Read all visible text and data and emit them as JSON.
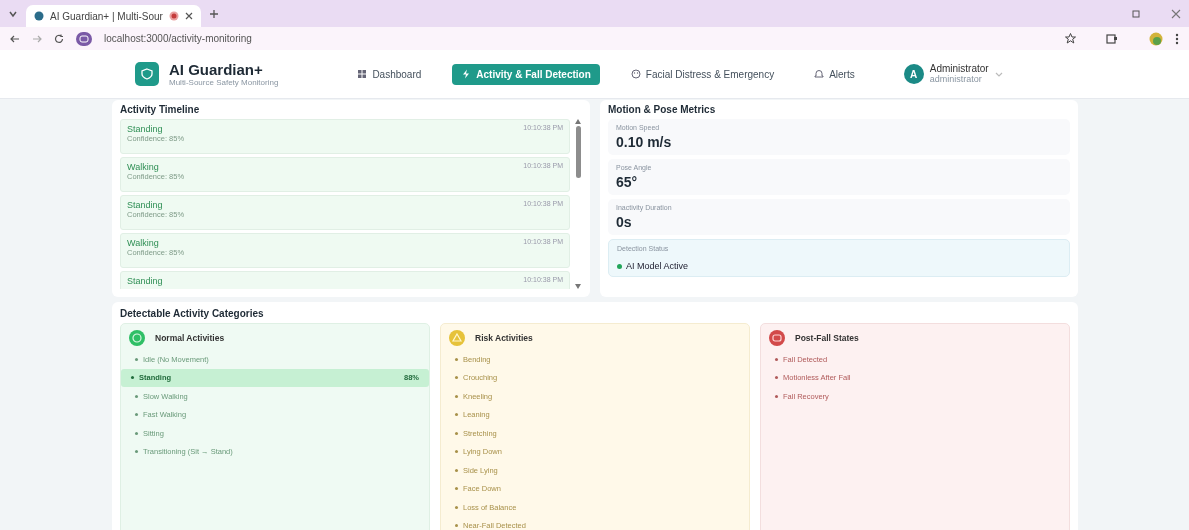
{
  "browser": {
    "tab_title": "AI Guardian+ | Multi-Sour",
    "url": "localhost:3000/activity-monitoring"
  },
  "header": {
    "title": "AI Guardian+",
    "subtitle": "Multi-Source Safety Monitoring",
    "nav": [
      {
        "label": "Dashboard",
        "selected": false
      },
      {
        "label": "Activity & Fall Detection",
        "selected": true
      },
      {
        "label": "Facial Distress & Emergency",
        "selected": false
      },
      {
        "label": "Alerts",
        "selected": false
      }
    ],
    "user": {
      "initial": "A",
      "name": "Administrator",
      "role": "administrator"
    }
  },
  "timeline": {
    "title": "Activity Timeline",
    "entries": [
      {
        "activity": "Standing",
        "confidence": "Confidence: 85%",
        "time": "10:10:38 PM"
      },
      {
        "activity": "Walking",
        "confidence": "Confidence: 85%",
        "time": "10:10:38 PM"
      },
      {
        "activity": "Standing",
        "confidence": "Confidence: 85%",
        "time": "10:10:38 PM"
      },
      {
        "activity": "Walking",
        "confidence": "Confidence: 85%",
        "time": "10:10:38 PM"
      },
      {
        "activity": "Standing",
        "time": "10:10:38 PM"
      }
    ]
  },
  "metrics": {
    "title": "Motion & Pose Metrics",
    "items": [
      {
        "kind": "value",
        "label": "Motion Speed",
        "value": "0.10 m/s"
      },
      {
        "kind": "value",
        "label": "Pose Angle",
        "value": "65°"
      },
      {
        "kind": "value",
        "label": "Inactivity Duration",
        "value": "0s"
      },
      {
        "kind": "status",
        "label": "Detection Status",
        "value": "AI Model Active",
        "color": "#22a55a"
      }
    ]
  },
  "categories": {
    "title": "Detectable Activity Categories",
    "groups": [
      {
        "kind": "normal",
        "title": "Normal Activities",
        "items": [
          {
            "label": "Idle (No Movement)",
            "selected": false
          },
          {
            "label": "Standing",
            "selected": true,
            "reading": "88%"
          },
          {
            "label": "Slow Walking",
            "selected": false
          },
          {
            "label": "Fast Walking",
            "selected": false
          },
          {
            "label": "Sitting",
            "selected": false
          },
          {
            "label": "Transitioning (Sit → Stand)",
            "selected": false
          }
        ]
      },
      {
        "kind": "risk",
        "title": "Risk Activities",
        "items": [
          {
            "label": "Bending",
            "selected": false
          },
          {
            "label": "Crouching",
            "selected": false
          },
          {
            "label": "Kneeling",
            "selected": false
          },
          {
            "label": "Leaning",
            "selected": false
          },
          {
            "label": "Stretching",
            "selected": false
          },
          {
            "label": "Lying Down",
            "selected": false
          },
          {
            "label": "Side Lying",
            "selected": false
          },
          {
            "label": "Face Down",
            "selected": false
          },
          {
            "label": "Loss of Balance",
            "selected": false
          },
          {
            "label": "Near-Fall Detected",
            "selected": false
          }
        ]
      },
      {
        "kind": "postfall",
        "title": "Post-Fall States",
        "items": [
          {
            "label": "Fall Detected",
            "selected": false
          },
          {
            "label": "Motionless After Fall",
            "selected": false
          },
          {
            "label": "Fall Recovery",
            "selected": false
          }
        ]
      }
    ]
  }
}
